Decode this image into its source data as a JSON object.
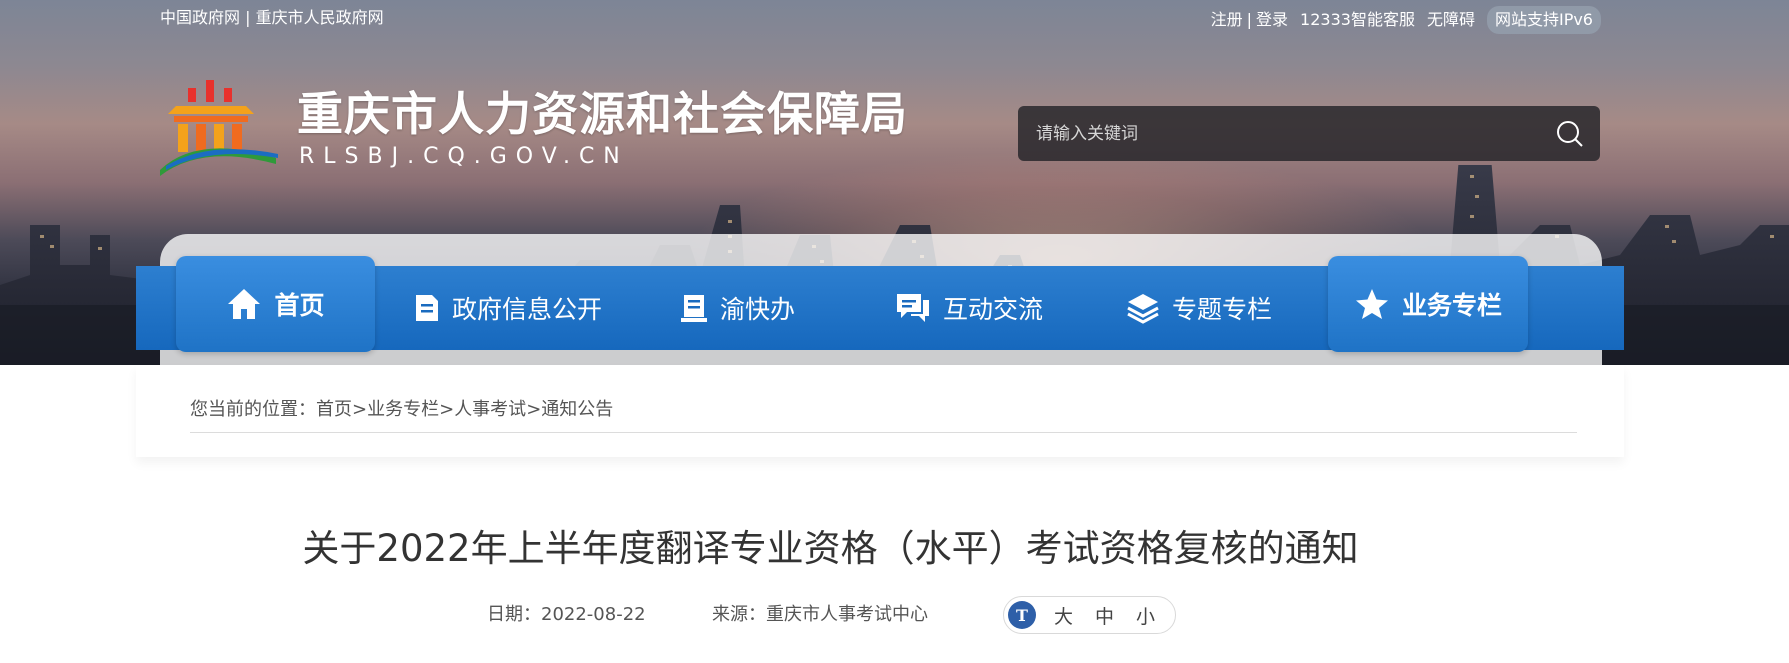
{
  "topbar": {
    "links_left": [
      "中国政府网",
      "重庆市人民政府网"
    ],
    "auth": [
      "注册",
      "登录"
    ],
    "links_right": [
      "12333智能客服",
      "无障碍"
    ],
    "ipv6_badge": "网站支持IPv6"
  },
  "header": {
    "site_title": "重庆市人力资源和社会保障局",
    "site_domain": "RLSBJ.CQ.GOV.CN",
    "search_placeholder": "请输入关键词"
  },
  "nav": {
    "items": [
      {
        "label": "首页",
        "icon": "home-icon"
      },
      {
        "label": "政府信息公开",
        "icon": "document-icon"
      },
      {
        "label": "渝快办",
        "icon": "book-icon"
      },
      {
        "label": "互动交流",
        "icon": "chat-icon"
      },
      {
        "label": "专题专栏",
        "icon": "layers-icon"
      },
      {
        "label": "业务专栏",
        "icon": "star-icon"
      }
    ]
  },
  "breadcrumb": {
    "prefix": "您当前的位置：",
    "items": [
      "首页",
      "业务专栏",
      "人事考试",
      "通知公告"
    ],
    "separator": ">"
  },
  "article": {
    "title": "关于2022年上半年度翻译专业资格（水平）考试资格复核的通知",
    "date_label": "日期：",
    "date": "2022-08-22",
    "source_label": "来源：",
    "source": "重庆市人事考试中心",
    "font_sizes": [
      "大",
      "中",
      "小"
    ]
  },
  "colors": {
    "nav_blue": "#1668bd",
    "font_icon_blue": "#2e5fa8"
  }
}
